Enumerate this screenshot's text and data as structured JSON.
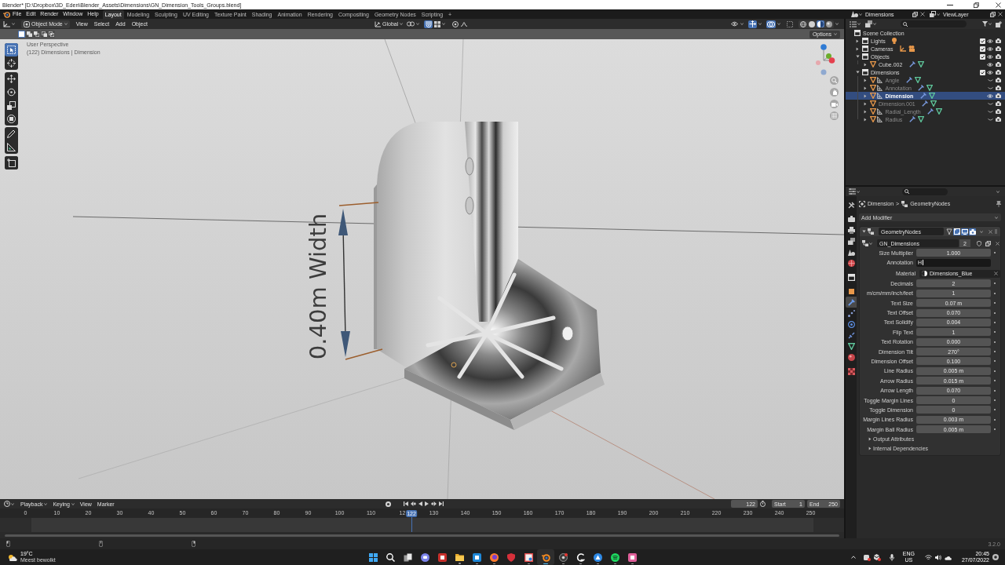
{
  "window": {
    "title": "Blender* [D:\\Dropbox\\3D_Eden\\Blender_Assets\\Dimensions\\GN_Dimension_Tools_Groups.blend]"
  },
  "topbar": {
    "menus": [
      "File",
      "Edit",
      "Render",
      "Window",
      "Help"
    ],
    "workspaces": [
      {
        "label": "Layout",
        "selected": true
      },
      {
        "label": "Modeling",
        "selected": false
      },
      {
        "label": "Sculpting",
        "selected": false
      },
      {
        "label": "UV Editing",
        "selected": false
      },
      {
        "label": "Texture Paint",
        "selected": false
      },
      {
        "label": "Shading",
        "selected": false
      },
      {
        "label": "Animation",
        "selected": false
      },
      {
        "label": "Rendering",
        "selected": false
      },
      {
        "label": "Compositing",
        "selected": false
      },
      {
        "label": "Geometry Nodes",
        "selected": false
      },
      {
        "label": "Scripting",
        "selected": false
      }
    ],
    "add_workspace": "+",
    "scene": "Dimensions",
    "view_layer": "ViewLayer"
  },
  "viewport": {
    "mode": "Object Mode",
    "menus": [
      "View",
      "Select",
      "Add",
      "Object"
    ],
    "orientation": "Global",
    "snap": {
      "on": true
    },
    "proportional": {
      "on": false
    },
    "display_toggles": [
      {
        "kind": "visibility",
        "on": false
      },
      {
        "kind": "gizmo",
        "on": true
      },
      {
        "kind": "overlay",
        "on": true
      },
      {
        "kind": "xray",
        "on": false
      }
    ],
    "shading": [
      {
        "kind": "wireframe",
        "selected": false
      },
      {
        "kind": "solid",
        "selected": false
      },
      {
        "kind": "material",
        "selected": true
      },
      {
        "kind": "rendered",
        "selected": false
      }
    ],
    "select_modes": [
      {
        "kind": "set",
        "selected": true
      },
      {
        "kind": "extend",
        "selected": false
      },
      {
        "kind": "subtract",
        "selected": false
      },
      {
        "kind": "invert",
        "selected": false
      },
      {
        "kind": "intersect",
        "selected": false
      }
    ],
    "options": "Options",
    "info": [
      "User Perspective",
      "(122) Dimensions | Dimension"
    ],
    "toolbar": [
      {
        "tools": [
          {
            "kind": "select-box",
            "selected": true
          },
          {
            "kind": "cursor",
            "selected": false
          }
        ]
      },
      {
        "tools": [
          {
            "kind": "move",
            "selected": false
          },
          {
            "kind": "rotate",
            "selected": false
          },
          {
            "kind": "scale",
            "selected": false
          },
          {
            "kind": "transform",
            "selected": false
          }
        ]
      },
      {
        "tools": [
          {
            "kind": "annotate",
            "selected": false
          },
          {
            "kind": "measure",
            "selected": false
          }
        ]
      },
      {
        "tools": [
          {
            "kind": "add-cube",
            "selected": false
          }
        ]
      }
    ],
    "annotation": "0.40m Width"
  },
  "timeline": {
    "menus": [
      {
        "label": "Playback",
        "dropdown": true
      },
      {
        "label": "Keying",
        "dropdown": true
      },
      {
        "label": "View",
        "dropdown": false
      },
      {
        "label": "Marker",
        "dropdown": false
      }
    ],
    "current_frame": "122",
    "start": {
      "label": "Start",
      "value": "1"
    },
    "end": {
      "label": "End",
      "value": "250"
    },
    "ruler": [
      "0",
      "10",
      "20",
      "30",
      "40",
      "50",
      "60",
      "70",
      "80",
      "90",
      "100",
      "110",
      "12",
      "130",
      "140",
      "150",
      "160",
      "170",
      "180",
      "190",
      "200",
      "210",
      "220",
      "230",
      "240",
      "250"
    ],
    "playhead": {
      "label": "122",
      "level": 0.488
    }
  },
  "outliner": {
    "tree": [
      {
        "label": "Scene Collection",
        "kind": "collection",
        "selected": false,
        "children": [
          {
            "label": "Lights",
            "kind": "collection",
            "expanded": false,
            "selected": false,
            "checked": true,
            "visible": true,
            "contents": [
              {
                "kind": "light"
              }
            ]
          },
          {
            "label": "Cameras",
            "kind": "collection",
            "expanded": false,
            "selected": false,
            "checked": true,
            "visible": true,
            "contents": [
              {
                "kind": "empty"
              },
              {
                "kind": "camera"
              }
            ]
          },
          {
            "label": "Objects",
            "kind": "collection",
            "expanded": true,
            "selected": false,
            "checked": true,
            "visible": true,
            "children": [
              {
                "label": "Cube.002",
                "kind": "object",
                "expanded": false,
                "selected": false,
                "visible": true,
                "tagged": false,
                "contents": [
                  {
                    "kind": "modifier"
                  },
                  {
                    "kind": "mesh"
                  }
                ]
              }
            ]
          },
          {
            "label": "Dimensions",
            "kind": "collection",
            "expanded": true,
            "selected": false,
            "checked": true,
            "visible": true,
            "children": [
              {
                "label": "Angle",
                "kind": "object",
                "expanded": false,
                "selected": false,
                "visible": false,
                "tagged": true,
                "contents": [
                  {
                    "kind": "modifier"
                  },
                  {
                    "kind": "mesh"
                  }
                ]
              },
              {
                "label": "Annotation",
                "kind": "object",
                "expanded": false,
                "selected": false,
                "visible": false,
                "tagged": true,
                "contents": [
                  {
                    "kind": "modifier"
                  },
                  {
                    "kind": "mesh"
                  }
                ]
              },
              {
                "label": "Dimension",
                "kind": "object",
                "expanded": false,
                "selected": true,
                "visible": true,
                "tagged": true,
                "contents": [
                  {
                    "kind": "modifier"
                  },
                  {
                    "kind": "mesh"
                  }
                ]
              },
              {
                "label": "Dimension.001",
                "kind": "object",
                "expanded": false,
                "selected": false,
                "visible": false,
                "tagged": false,
                "contents": [
                  {
                    "kind": "modifier"
                  },
                  {
                    "kind": "mesh"
                  }
                ]
              },
              {
                "label": "Radial_Length",
                "kind": "object",
                "expanded": false,
                "selected": false,
                "visible": false,
                "tagged": true,
                "contents": [
                  {
                    "kind": "modifier"
                  },
                  {
                    "kind": "mesh"
                  }
                ]
              },
              {
                "label": "Radius",
                "kind": "object",
                "expanded": false,
                "selected": false,
                "visible": false,
                "tagged": true,
                "contents": [
                  {
                    "kind": "modifier"
                  },
                  {
                    "kind": "mesh"
                  }
                ]
              }
            ]
          }
        ]
      }
    ]
  },
  "properties": {
    "tab_groups": [
      {
        "tabs": [
          {
            "kind": "tool",
            "selected": false
          }
        ]
      },
      {
        "tabs": [
          {
            "kind": "render",
            "selected": false
          },
          {
            "kind": "output",
            "selected": false
          },
          {
            "kind": "view-layer",
            "selected": false
          },
          {
            "kind": "scene",
            "selected": false
          },
          {
            "kind": "world",
            "selected": false
          }
        ]
      },
      {
        "tabs": [
          {
            "kind": "collection",
            "selected": false
          }
        ]
      },
      {
        "tabs": [
          {
            "kind": "object",
            "selected": false
          },
          {
            "kind": "modifier",
            "selected": true
          },
          {
            "kind": "particles",
            "selected": false
          },
          {
            "kind": "physics",
            "selected": false
          },
          {
            "kind": "constraints",
            "selected": false
          },
          {
            "kind": "data",
            "selected": false
          },
          {
            "kind": "material",
            "selected": false
          }
        ]
      },
      {
        "tabs": [
          {
            "kind": "texture",
            "selected": false
          }
        ]
      }
    ],
    "breadcrumb": [
      {
        "kind": "object",
        "label": "Dimension"
      },
      {
        "kind": "modifier",
        "label": "GeometryNodes"
      }
    ],
    "breadcrumb_separator": ">",
    "add_modifier": "Add Modifier",
    "modifier": {
      "name": "GeometryNodes",
      "expanded": true,
      "toggles": [
        {
          "kind": "on-cage",
          "on": false
        },
        {
          "kind": "edit-mode",
          "on": true
        },
        {
          "kind": "viewport",
          "on": true
        },
        {
          "kind": "render",
          "on": true
        }
      ],
      "node_group": "GN_Dimensions",
      "users": "2",
      "inputs": [
        {
          "label": "Size Multiplier",
          "kind": "number",
          "value": "1.000"
        },
        {
          "label": "Annotation",
          "kind": "text",
          "value": "H",
          "editing": true
        },
        {
          "label": "Material",
          "kind": "material",
          "value": "Dimensions_Blue"
        },
        {
          "label": "Decimals",
          "kind": "number",
          "value": "2"
        },
        {
          "label": "m/cm/mm/inch/feet",
          "kind": "number",
          "value": "1"
        },
        {
          "label": "Text Size",
          "kind": "number",
          "value": "0.07 m"
        },
        {
          "label": "Text Offset",
          "kind": "number",
          "value": "0.070"
        },
        {
          "label": "Text Solidify",
          "kind": "number",
          "value": "0.004"
        },
        {
          "label": "Flip Text",
          "kind": "number",
          "value": "1"
        },
        {
          "label": "Text Rotation",
          "kind": "number",
          "value": "0.000"
        },
        {
          "label": "Dimension Tilt",
          "kind": "number",
          "value": "270°"
        },
        {
          "label": "Dimension Offset",
          "kind": "number",
          "value": "0.100"
        },
        {
          "label": "Line Radius",
          "kind": "number",
          "value": "0.005 m"
        },
        {
          "label": "Arrow Radius",
          "kind": "number",
          "value": "0.015 m"
        },
        {
          "label": "Arrow Length",
          "kind": "number",
          "value": "0.070"
        },
        {
          "label": "Toggle Margin Lines",
          "kind": "number",
          "value": "0"
        },
        {
          "label": "Toggle Dimension",
          "kind": "number",
          "value": "0"
        },
        {
          "label": "Margin Lines Radius",
          "kind": "number",
          "value": "0.003 m"
        },
        {
          "label": "Margin Ball Radius",
          "kind": "number",
          "value": "0.005 m"
        }
      ],
      "subpanels": [
        {
          "label": "Output Attributes",
          "expanded": false
        },
        {
          "label": "Internal Dependencies",
          "expanded": false
        }
      ]
    }
  },
  "status_bar": {
    "hints": [
      {
        "kind": "left-click"
      },
      {
        "kind": "middle-click"
      },
      {
        "kind": "right-click"
      }
    ],
    "version": "3.2.0"
  },
  "taskbar": {
    "weather": {
      "temperature": "19°C",
      "condition": "Meest bewolkt"
    },
    "apps": [
      {
        "kind": "start",
        "running": false,
        "active": false
      },
      {
        "kind": "search",
        "running": false,
        "active": false
      },
      {
        "kind": "task-view",
        "running": false,
        "active": false
      },
      {
        "kind": "chat",
        "running": false,
        "active": false
      },
      {
        "kind": "tile",
        "color": "#c8302c",
        "running": false,
        "active": false
      },
      {
        "kind": "folder",
        "running": true,
        "active": false
      },
      {
        "kind": "tile",
        "color": "#1e88d8",
        "running": true,
        "active": false
      },
      {
        "kind": "browser",
        "running": true,
        "active": false
      },
      {
        "kind": "shield",
        "running": false,
        "active": false
      },
      {
        "kind": "snip",
        "running": true,
        "active": false
      },
      {
        "kind": "ring",
        "running": true,
        "active": true
      },
      {
        "kind": "aperture",
        "running": true,
        "active": false
      },
      {
        "kind": "arc",
        "running": true,
        "active": false
      },
      {
        "kind": "circle",
        "running": true,
        "active": false
      },
      {
        "kind": "music",
        "running": true,
        "active": false
      },
      {
        "kind": "tile",
        "color": "#e0609a",
        "running": true,
        "active": false
      }
    ],
    "tray": {
      "language": "ENG",
      "region": "US",
      "time": "20:45",
      "date": "27/07/2022"
    }
  }
}
